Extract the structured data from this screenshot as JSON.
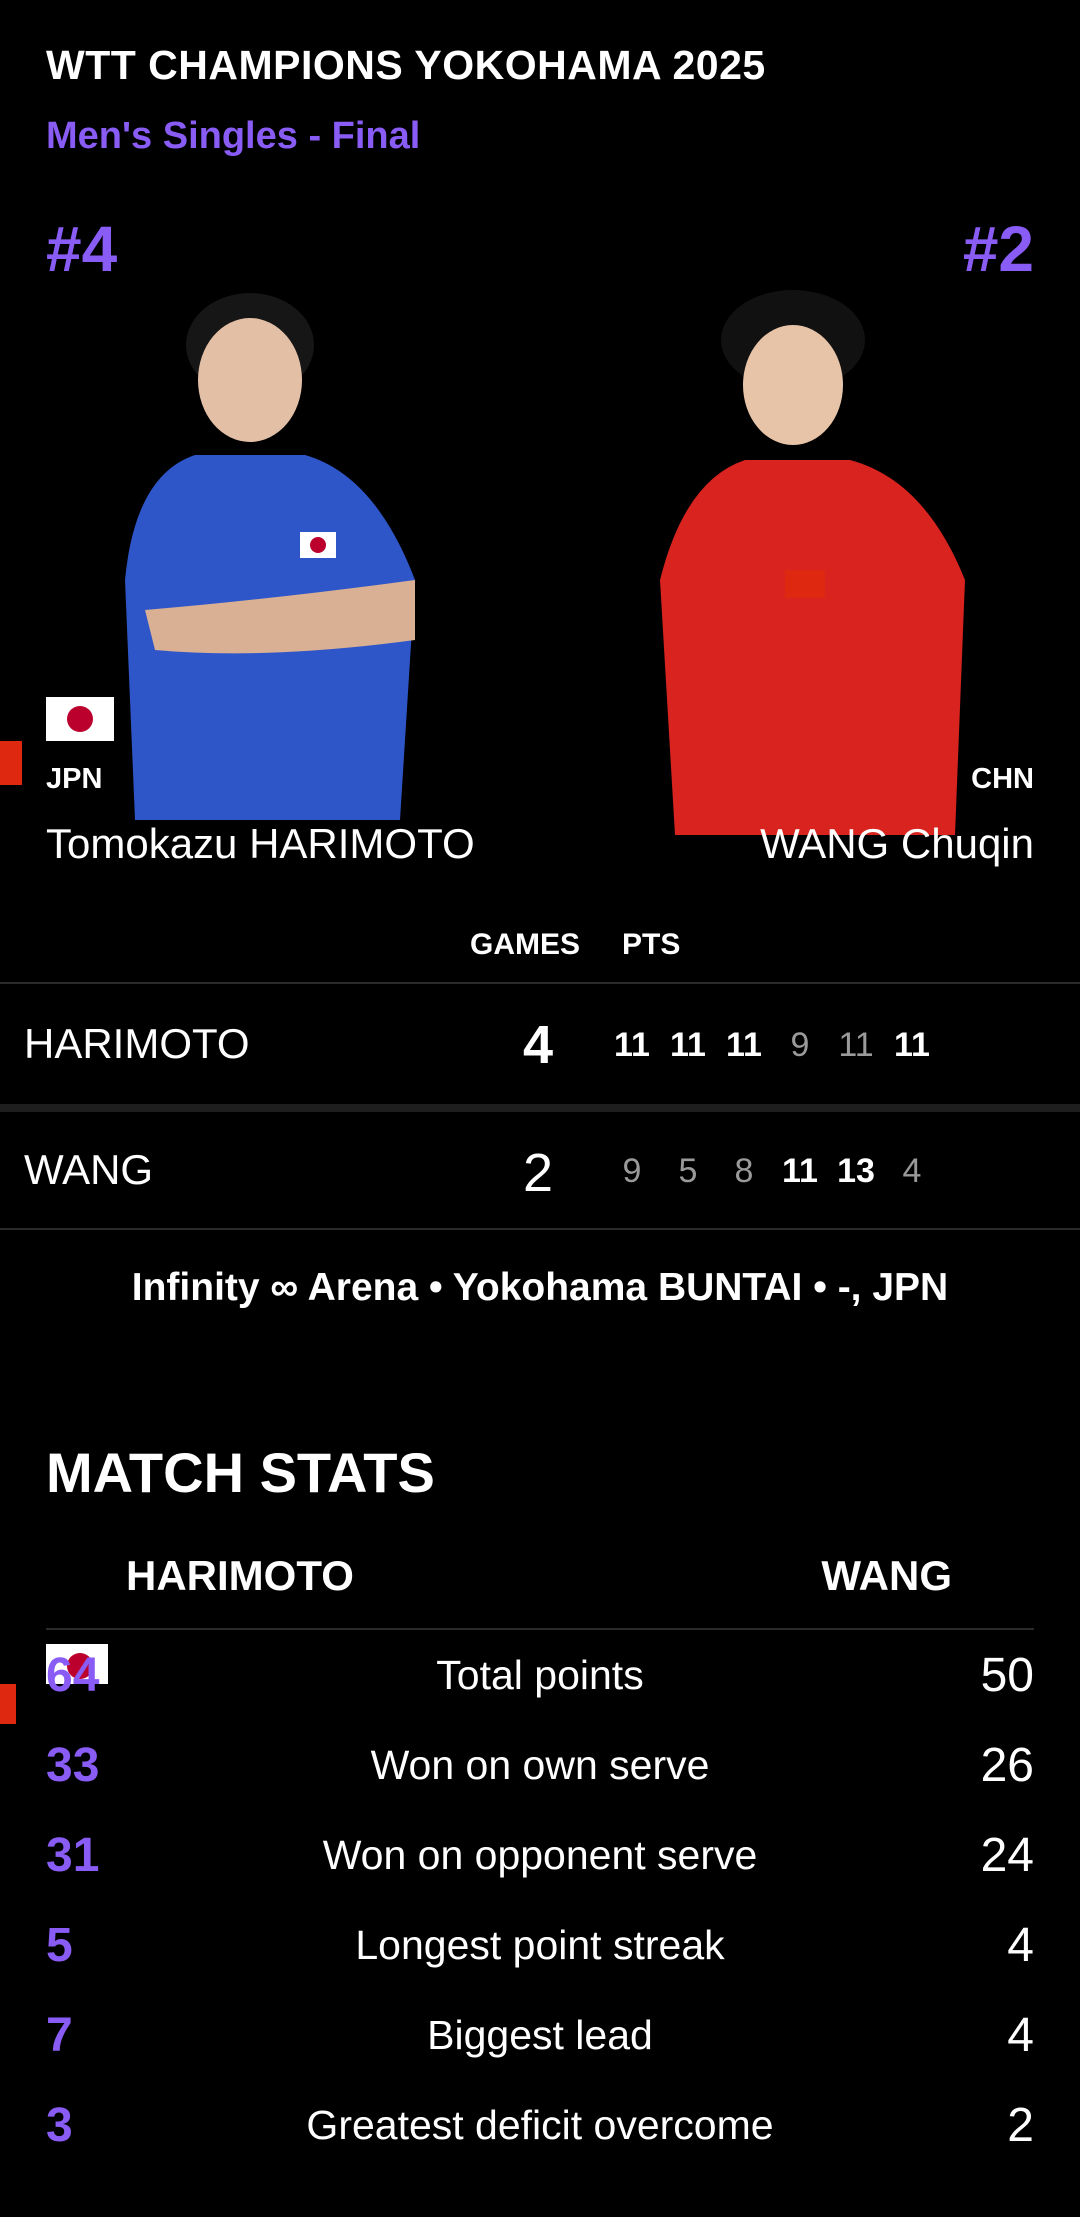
{
  "header": {
    "title": "WTT CHAMPIONS YOKOHAMA 2025",
    "subtitle": "Men's Singles - Final"
  },
  "players": {
    "left": {
      "seed": "#4",
      "country": "JPN",
      "name": "Tomokazu HARIMOTO",
      "jersey_color": "#2f56c9"
    },
    "right": {
      "seed": "#2",
      "country": "CHN",
      "name": "WANG Chuqin",
      "jersey_color": "#d8231f"
    }
  },
  "scoreboard": {
    "games_header": "GAMES",
    "pts_header": "PTS",
    "rows": [
      {
        "name": "HARIMOTO",
        "games": "4",
        "points": [
          "11",
          "11",
          "11",
          "9",
          "11",
          "11"
        ],
        "wins": [
          true,
          true,
          true,
          false,
          false,
          true
        ]
      },
      {
        "name": "WANG",
        "games": "2",
        "points": [
          "9",
          "5",
          "8",
          "11",
          "13",
          "4"
        ],
        "wins": [
          false,
          false,
          false,
          true,
          true,
          false
        ]
      }
    ]
  },
  "venue": "Infinity ∞ Arena • Yokohama BUNTAI • -,  JPN",
  "match_stats": {
    "title": "MATCH STATS",
    "left_team": "HARIMOTO",
    "right_team": "WANG",
    "rows": [
      {
        "left": "64",
        "label": "Total points",
        "right": "50"
      },
      {
        "left": "33",
        "label": "Won on own serve",
        "right": "26"
      },
      {
        "left": "31",
        "label": "Won on opponent serve",
        "right": "24"
      },
      {
        "left": "5",
        "label": "Longest point streak",
        "right": "4"
      },
      {
        "left": "7",
        "label": "Biggest lead",
        "right": "4"
      },
      {
        "left": "3",
        "label": "Greatest deficit overcome",
        "right": "2"
      }
    ]
  },
  "colors": {
    "accent": "#8a5cf6",
    "background": "#000000"
  }
}
